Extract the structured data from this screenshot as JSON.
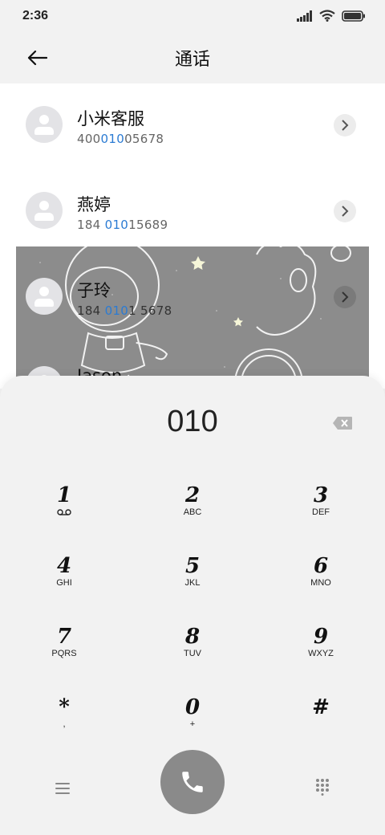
{
  "status": {
    "time": "2:36"
  },
  "header": {
    "title": "通话"
  },
  "contacts": [
    {
      "name": "小米客服",
      "num_pre": "400",
      "num_hl": "010",
      "num_post": "05678"
    },
    {
      "name": "燕婷",
      "num_pre": "184 ",
      "num_hl": "010",
      "num_post": "15689"
    },
    {
      "name": "子玲",
      "num_pre": "184 ",
      "num_hl": "010",
      "num_post": "1 5678"
    },
    {
      "name": "Jason",
      "num_pre": "",
      "num_hl": "",
      "num_post": ""
    }
  ],
  "dialer": {
    "input": "010",
    "keys": [
      {
        "main": "1",
        "sub": "voicemail"
      },
      {
        "main": "2",
        "sub": "ABC"
      },
      {
        "main": "3",
        "sub": "DEF"
      },
      {
        "main": "4",
        "sub": "GHI"
      },
      {
        "main": "5",
        "sub": "JKL"
      },
      {
        "main": "6",
        "sub": "MNO"
      },
      {
        "main": "7",
        "sub": "PQRS"
      },
      {
        "main": "8",
        "sub": "TUV"
      },
      {
        "main": "9",
        "sub": "WXYZ"
      },
      {
        "main": "*",
        "sub": ","
      },
      {
        "main": "0",
        "sub": "+"
      },
      {
        "main": "#",
        "sub": ""
      }
    ]
  },
  "colors": {
    "accent": "#2b7bd3",
    "call_button": "#8a8a8a"
  }
}
